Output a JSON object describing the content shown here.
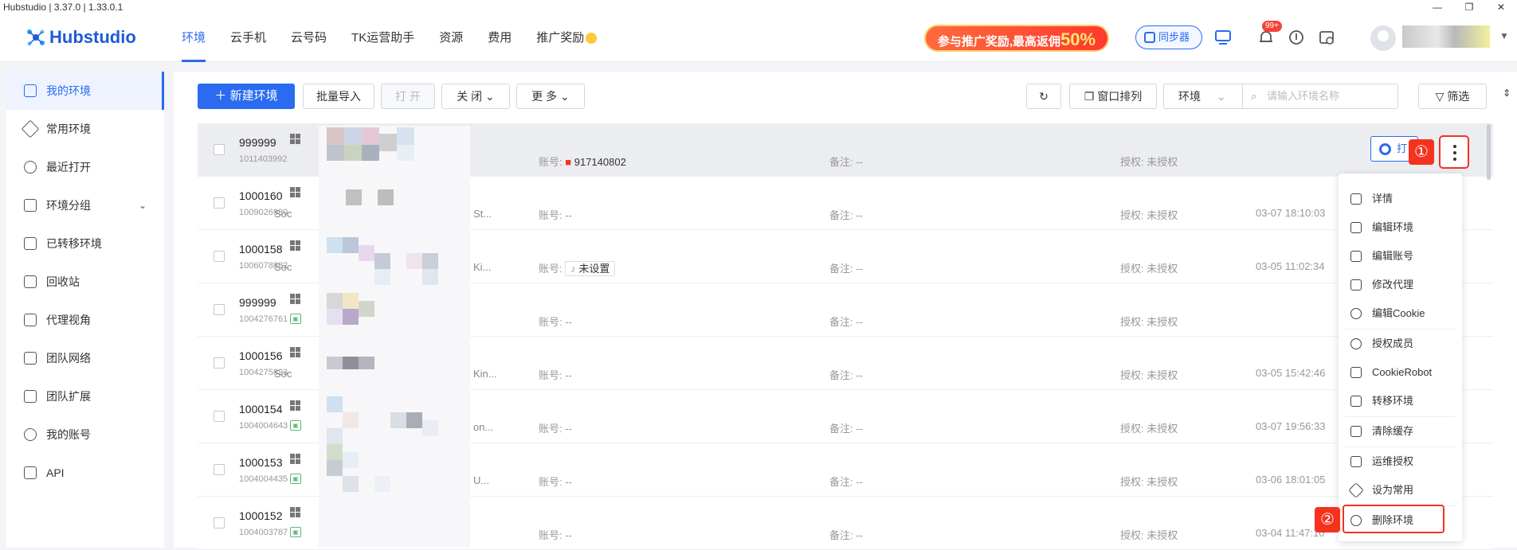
{
  "titlebar": {
    "title": "Hubstudio | 3.37.0 | 1.33.0.1"
  },
  "header": {
    "logo": "Hubstudio",
    "nav": [
      "环境",
      "云手机",
      "云号码",
      "TK运营助手",
      "资源",
      "费用",
      "推广奖励"
    ],
    "promo_text": "参与推广奖励,最高返佣",
    "promo_pct": "50%",
    "sync_label": "同步器",
    "notif_badge": "99+"
  },
  "sidebar": {
    "items": [
      {
        "label": "我的环境",
        "icon": "folder-icon"
      },
      {
        "label": "常用环境",
        "icon": "star-icon"
      },
      {
        "label": "最近打开",
        "icon": "clock-icon"
      },
      {
        "label": "环境分组",
        "icon": "layers-icon"
      },
      {
        "label": "已转移环境",
        "icon": "transfer-icon"
      },
      {
        "label": "回收站",
        "icon": "trash-icon"
      },
      {
        "label": "代理视角",
        "icon": "proxy-icon"
      },
      {
        "label": "团队网络",
        "icon": "network-icon"
      },
      {
        "label": "团队扩展",
        "icon": "extension-icon"
      },
      {
        "label": "我的账号",
        "icon": "user-icon"
      },
      {
        "label": "API",
        "icon": "api-icon"
      }
    ]
  },
  "toolbar": {
    "new_env": "新建环境",
    "batch_import": "批量导入",
    "open": "打 开",
    "close": "关 闭",
    "more": "更 多",
    "window_arrange": "窗口排列",
    "env_select": "环境",
    "search_placeholder": "请输入环境名称",
    "filter": "筛选"
  },
  "rows": [
    {
      "name": "999999",
      "id": "1011403992",
      "proxy": "",
      "account_label": "账号:",
      "account": "917140802",
      "remark": "备注: --",
      "auth": "授权: 未授权",
      "date": ""
    },
    {
      "name": "1000160",
      "id": "1009026980",
      "proxy": "Soc",
      "account_label": "账号:",
      "account": "--",
      "remark": "备注: --",
      "auth": "授权: 未授权",
      "date": "03-07 18:10:03",
      "extra": "St..."
    },
    {
      "name": "1000158",
      "id": "1006078882",
      "proxy": "Soc",
      "account_label": "账号:",
      "account": "未设置",
      "remark": "备注: --",
      "auth": "授权: 未授权",
      "date": "03-05 11:02:34",
      "extra": "Ki..."
    },
    {
      "name": "999999",
      "id": "1004276761",
      "proxy": "",
      "account_label": "账号:",
      "account": "--",
      "remark": "备注: --",
      "auth": "授权: 未授权",
      "date": ""
    },
    {
      "name": "1000156",
      "id": "1004275823",
      "proxy": "Soc",
      "account_label": "账号:",
      "account": "--",
      "remark": "备注: --",
      "auth": "授权: 未授权",
      "date": "03-05 15:42:46",
      "extra": "Kin..."
    },
    {
      "name": "1000154",
      "id": "1004004643",
      "proxy": "",
      "account_label": "账号:",
      "account": "--",
      "remark": "备注: --",
      "auth": "授权: 未授权",
      "date": "03-07 19:56:33",
      "extra": "on..."
    },
    {
      "name": "1000153",
      "id": "1004004435",
      "proxy": "",
      "account_label": "账号:",
      "account": "--",
      "remark": "备注: --",
      "auth": "授权: 未授权",
      "date": "03-06 18:01:05",
      "extra": "U..."
    },
    {
      "name": "1000152",
      "id": "1004003787",
      "proxy": "",
      "account_label": "账号:",
      "account": "--",
      "remark": "备注: --",
      "auth": "授权: 未授权",
      "date": "03-04 11:47:10",
      "extra": ""
    }
  ],
  "open_btn": "打",
  "markers": {
    "one": "①",
    "two": "②"
  },
  "menu": [
    "详情",
    "编辑环境",
    "编辑账号",
    "修改代理",
    "编辑Cookie",
    "授权成员",
    "CookieRobot",
    "转移环境",
    "清除缓存",
    "运维授权",
    "设为常用",
    "删除环境"
  ]
}
